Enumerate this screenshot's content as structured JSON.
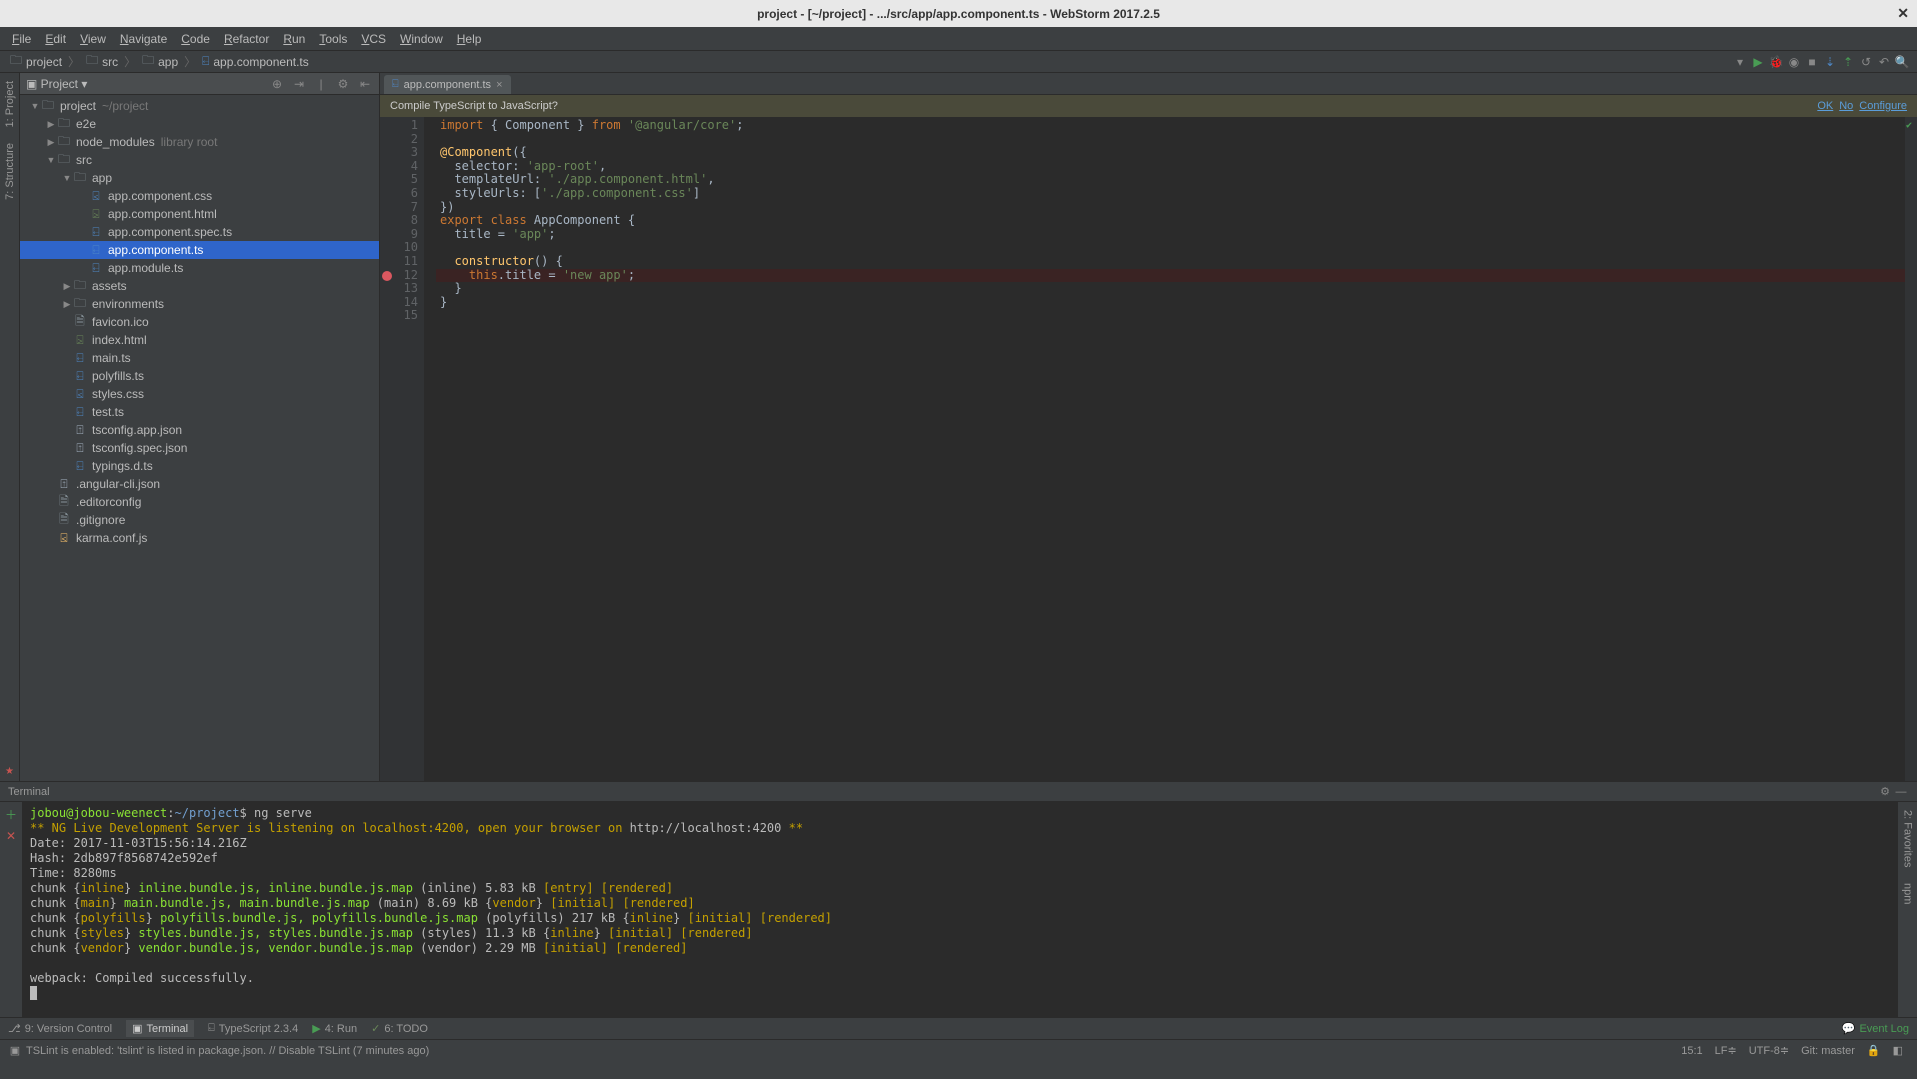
{
  "window": {
    "title": "project - [~/project] - .../src/app/app.component.ts - WebStorm 2017.2.5"
  },
  "menu": [
    "File",
    "Edit",
    "View",
    "Navigate",
    "Code",
    "Refactor",
    "Run",
    "Tools",
    "VCS",
    "Window",
    "Help"
  ],
  "breadcrumbs": [
    {
      "icon": "folder",
      "label": "project"
    },
    {
      "icon": "folder",
      "label": "src"
    },
    {
      "icon": "folder",
      "label": "app"
    },
    {
      "icon": "ts",
      "label": "app.component.ts"
    }
  ],
  "project_header": {
    "label": "Project"
  },
  "left_tabs": [
    "1: Project",
    "7: Structure"
  ],
  "right_tabs": [],
  "tree": [
    {
      "d": 0,
      "a": "▼",
      "i": "folder",
      "t": "project",
      "hint": "~/project"
    },
    {
      "d": 1,
      "a": "▶",
      "i": "folder",
      "t": "e2e"
    },
    {
      "d": 1,
      "a": "▶",
      "i": "folder",
      "t": "node_modules",
      "hint": "library root"
    },
    {
      "d": 1,
      "a": "▼",
      "i": "folder",
      "t": "src"
    },
    {
      "d": 2,
      "a": "▼",
      "i": "folder",
      "t": "app"
    },
    {
      "d": 3,
      "a": "",
      "i": "css",
      "t": "app.component.css"
    },
    {
      "d": 3,
      "a": "",
      "i": "html",
      "t": "app.component.html"
    },
    {
      "d": 3,
      "a": "",
      "i": "ts",
      "t": "app.component.spec.ts"
    },
    {
      "d": 3,
      "a": "",
      "i": "ts",
      "t": "app.component.ts",
      "sel": true
    },
    {
      "d": 3,
      "a": "",
      "i": "ts",
      "t": "app.module.ts"
    },
    {
      "d": 2,
      "a": "▶",
      "i": "folder",
      "t": "assets"
    },
    {
      "d": 2,
      "a": "▶",
      "i": "folder",
      "t": "environments"
    },
    {
      "d": 2,
      "a": "",
      "i": "file",
      "t": "favicon.ico"
    },
    {
      "d": 2,
      "a": "",
      "i": "html",
      "t": "index.html"
    },
    {
      "d": 2,
      "a": "",
      "i": "ts",
      "t": "main.ts"
    },
    {
      "d": 2,
      "a": "",
      "i": "ts",
      "t": "polyfills.ts"
    },
    {
      "d": 2,
      "a": "",
      "i": "css",
      "t": "styles.css"
    },
    {
      "d": 2,
      "a": "",
      "i": "ts",
      "t": "test.ts"
    },
    {
      "d": 2,
      "a": "",
      "i": "json",
      "t": "tsconfig.app.json"
    },
    {
      "d": 2,
      "a": "",
      "i": "json",
      "t": "tsconfig.spec.json"
    },
    {
      "d": 2,
      "a": "",
      "i": "ts",
      "t": "typings.d.ts"
    },
    {
      "d": 1,
      "a": "",
      "i": "json",
      "t": ".angular-cli.json"
    },
    {
      "d": 1,
      "a": "",
      "i": "file",
      "t": ".editorconfig"
    },
    {
      "d": 1,
      "a": "",
      "i": "file",
      "t": ".gitignore"
    },
    {
      "d": 1,
      "a": "",
      "i": "js",
      "t": "karma.conf.js"
    }
  ],
  "editor_tab": {
    "label": "app.component.ts"
  },
  "compile_bar": {
    "text": "Compile TypeScript to JavaScript?",
    "ok": "OK",
    "no": "No",
    "cfg": "Configure"
  },
  "code": {
    "breakpoint_line": 12,
    "lines": [
      [
        {
          "c": "k-orange",
          "t": "import"
        },
        {
          "c": "k-white",
          "t": " { Component } "
        },
        {
          "c": "k-orange",
          "t": "from"
        },
        {
          "c": "k-white",
          "t": " "
        },
        {
          "c": "k-str",
          "t": "'@angular/core'"
        },
        {
          "c": "k-white",
          "t": ";"
        }
      ],
      [],
      [
        {
          "c": "k-yellow",
          "t": "@Component"
        },
        {
          "c": "k-white",
          "t": "({"
        }
      ],
      [
        {
          "c": "k-white",
          "t": "  selector: "
        },
        {
          "c": "k-str",
          "t": "'app-root'"
        },
        {
          "c": "k-white",
          "t": ","
        }
      ],
      [
        {
          "c": "k-white",
          "t": "  templateUrl: "
        },
        {
          "c": "k-str",
          "t": "'./app.component.html'"
        },
        {
          "c": "k-white",
          "t": ","
        }
      ],
      [
        {
          "c": "k-white",
          "t": "  styleUrls: ["
        },
        {
          "c": "k-str",
          "t": "'./app.component.css'"
        },
        {
          "c": "k-white",
          "t": "]"
        }
      ],
      [
        {
          "c": "k-white",
          "t": "})"
        }
      ],
      [
        {
          "c": "k-orange",
          "t": "export class"
        },
        {
          "c": "k-white",
          "t": " AppComponent {"
        }
      ],
      [
        {
          "c": "k-white",
          "t": "  title = "
        },
        {
          "c": "k-str",
          "t": "'app'"
        },
        {
          "c": "k-white",
          "t": ";"
        }
      ],
      [],
      [
        {
          "c": "k-yellow",
          "t": "  constructor"
        },
        {
          "c": "k-white",
          "t": "() {"
        }
      ],
      [
        {
          "c": "k-orange",
          "t": "    this"
        },
        {
          "c": "k-white",
          "t": ".title = "
        },
        {
          "c": "k-str",
          "t": "'new app'"
        },
        {
          "c": "k-white",
          "t": ";"
        }
      ],
      [
        {
          "c": "k-white",
          "t": "  }"
        }
      ],
      [
        {
          "c": "k-white",
          "t": "}"
        }
      ],
      []
    ]
  },
  "terminal": {
    "header": "Terminal",
    "prompt_user": "jobou@jobou-weenect",
    "prompt_path": "~/project",
    "prompt_cmd": "ng serve",
    "lines": [
      {
        "type": "banner",
        "pre": "** NG Live Development Server is listening on localhost:4200, open your browser on ",
        "url": "http://localhost:4200",
        "post": " **"
      },
      {
        "type": "plain",
        "t": "Date: 2017-11-03T15:56:14.216Z"
      },
      {
        "type": "plain",
        "t": "Hash: 2db897f8568742e592ef"
      },
      {
        "type": "plain",
        "t": "Time: 8280ms"
      },
      {
        "type": "chunk",
        "name": "inline",
        "files": "inline.bundle.js, inline.bundle.js.map",
        "meta": " (inline) 5.83 kB ",
        "tags": [
          "[entry]",
          "[rendered]"
        ]
      },
      {
        "type": "chunk",
        "name": "main",
        "files": "main.bundle.js, main.bundle.js.map",
        "meta": " (main) 8.69 kB {",
        "vendor": "vendor",
        "meta2": "} ",
        "tags": [
          "[initial]",
          "[rendered]"
        ]
      },
      {
        "type": "chunk",
        "name": "polyfills",
        "files": "polyfills.bundle.js, polyfills.bundle.js.map",
        "meta": " (polyfills) 217 kB {",
        "vendor": "inline",
        "meta2": "} ",
        "tags": [
          "[initial]",
          "[rendered]"
        ]
      },
      {
        "type": "chunk",
        "name": "styles",
        "files": "styles.bundle.js, styles.bundle.js.map",
        "meta": " (styles) 11.3 kB {",
        "vendor": "inline",
        "meta2": "} ",
        "tags": [
          "[initial]",
          "[rendered]"
        ]
      },
      {
        "type": "chunk",
        "name": "vendor",
        "files": "vendor.bundle.js, vendor.bundle.js.map",
        "meta": " (vendor) 2.29 MB ",
        "tags": [
          "[initial]",
          "[rendered]"
        ]
      },
      {
        "type": "blank"
      },
      {
        "type": "plain",
        "t": "webpack: Compiled successfully."
      }
    ]
  },
  "bottom_tabs": [
    {
      "icon": "vcs",
      "label": "9: Version Control"
    },
    {
      "icon": "term",
      "label": "Terminal",
      "active": true
    },
    {
      "icon": "ts",
      "label": "TypeScript 2.3.4"
    },
    {
      "icon": "run",
      "label": "4: Run"
    },
    {
      "icon": "todo",
      "label": "6: TODO"
    }
  ],
  "event_log": "Event Log",
  "status": {
    "msg": "TSLint is enabled: 'tslint' is listed in package.json. // Disable TSLint (7 minutes ago)",
    "pos": "15:1",
    "lf": "LF",
    "enc": "UTF-8",
    "git": "Git: master"
  }
}
